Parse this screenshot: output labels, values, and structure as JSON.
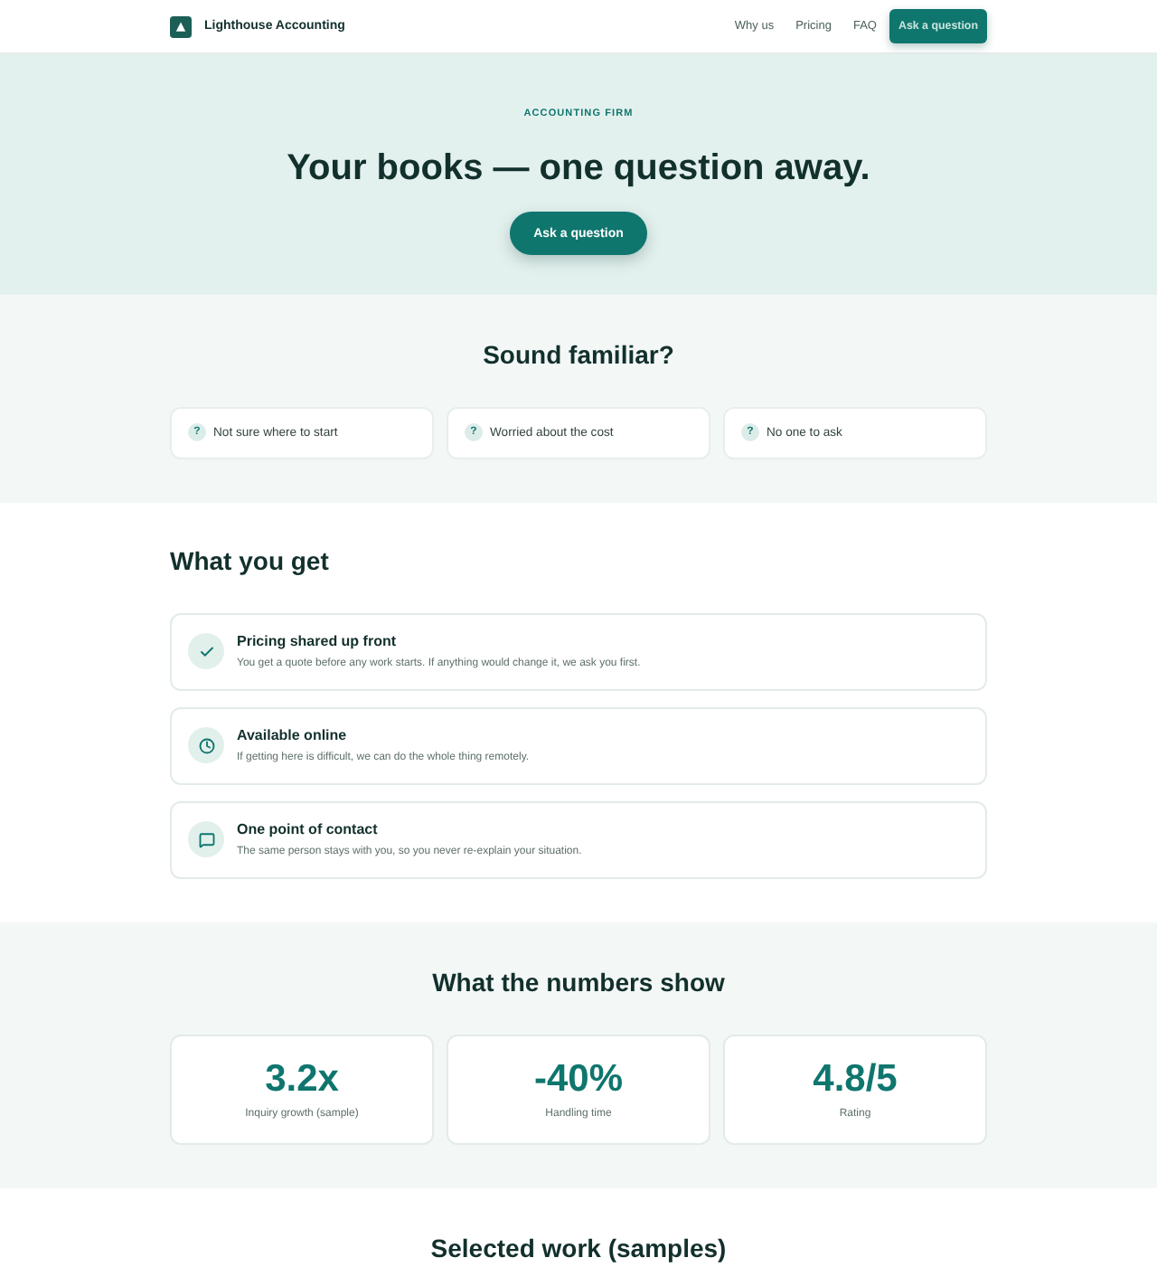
{
  "header": {
    "brand": "Lighthouse Accounting",
    "nav": [
      "Why us",
      "Pricing",
      "FAQ"
    ],
    "cta": "Ask a question"
  },
  "hero": {
    "eyebrow": "ACCOUNTING FIRM",
    "title": "Your books — one question away.",
    "button": "Ask a question"
  },
  "pain_points": {
    "title": "Sound familiar?",
    "items": [
      {
        "icon": "?",
        "text": "Not sure where to start"
      },
      {
        "icon": "?",
        "text": "Worried about the cost"
      },
      {
        "icon": "?",
        "text": "No one to ask"
      }
    ]
  },
  "features": {
    "title": "What you get",
    "items": [
      {
        "kind": "check",
        "title": "Pricing shared up front",
        "description": "You get a quote before any work starts. If anything would change it, we ask you first."
      },
      {
        "kind": "clock",
        "title": "Available online",
        "description": "If getting here is difficult, we can do the whole thing remotely."
      },
      {
        "kind": "message",
        "title": "One point of contact",
        "description": "The same person stays with you, so you never re-explain your situation."
      }
    ]
  },
  "stats": {
    "title": "What the numbers show",
    "items": [
      {
        "value": "3.2x",
        "label": "Inquiry growth (sample)"
      },
      {
        "value": "-40%",
        "label": "Handling time"
      },
      {
        "value": "4.8/5",
        "label": "Rating"
      }
    ]
  },
  "work": {
    "title": "Selected work (samples)"
  }
}
